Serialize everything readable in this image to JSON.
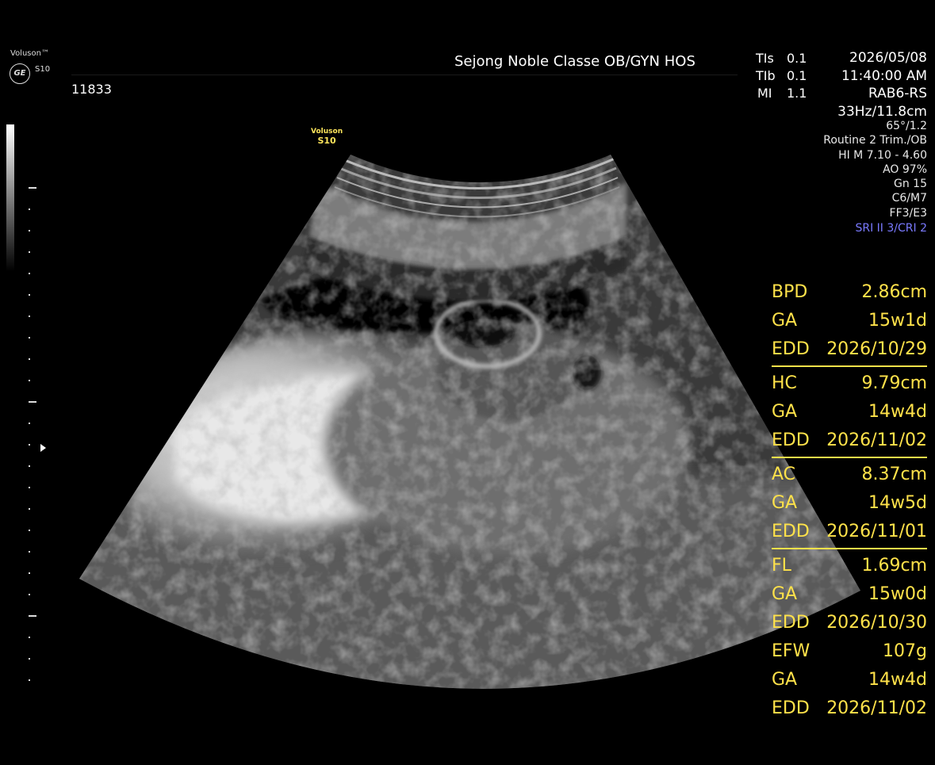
{
  "header": {
    "brand": "Voluson™",
    "brand_model": "S10",
    "logo": "GE",
    "patient_id": "11833",
    "hospital": "Sejong Noble Classe OB/GYN HOS",
    "indices": [
      {
        "label": "TIs",
        "value": "0.1"
      },
      {
        "label": "TIb",
        "value": "0.1"
      },
      {
        "label": "MI",
        "value": "1.1"
      }
    ],
    "date": "2026/05/08",
    "time": "11:40:00 AM"
  },
  "probe_label": {
    "line1": "Voluson",
    "line2": "S10"
  },
  "settings": [
    "RAB6-RS",
    "33Hz/11.8cm",
    "65°/1.2",
    "Routine 2 Trim./OB",
    "HI M  7.10 - 4.60",
    "AO 97%",
    "Gn  15",
    "C6/M7",
    "FF3/E3"
  ],
  "sri": "SRI II 3/CRI 2",
  "measurements": [
    {
      "key": "BPD",
      "value": "2.86cm",
      "ga_label": "GA",
      "ga": "15w1d",
      "edd_label": "EDD",
      "edd": "2026/10/29"
    },
    {
      "key": "HC",
      "value": "9.79cm",
      "ga_label": "GA",
      "ga": "14w4d",
      "edd_label": "EDD",
      "edd": "2026/11/02"
    },
    {
      "key": "AC",
      "value": "8.37cm",
      "ga_label": "GA",
      "ga": "14w5d",
      "edd_label": "EDD",
      "edd": "2026/11/01"
    },
    {
      "key": "FL",
      "value": "1.69cm",
      "ga_label": "GA",
      "ga": "15w0d",
      "edd_label": "EDD",
      "edd": "2026/10/30"
    },
    {
      "key": "EFW",
      "value": "107g",
      "ga_label": "GA",
      "ga": "14w4d",
      "edd_label": "EDD",
      "edd": "2026/11/02"
    }
  ],
  "colors": {
    "measurement": "#ffe24a",
    "sri": "#7a7aff",
    "probe_label": "#ffe65c"
  },
  "icons": [
    "ge-logo-icon",
    "focus-marker-icon"
  ]
}
